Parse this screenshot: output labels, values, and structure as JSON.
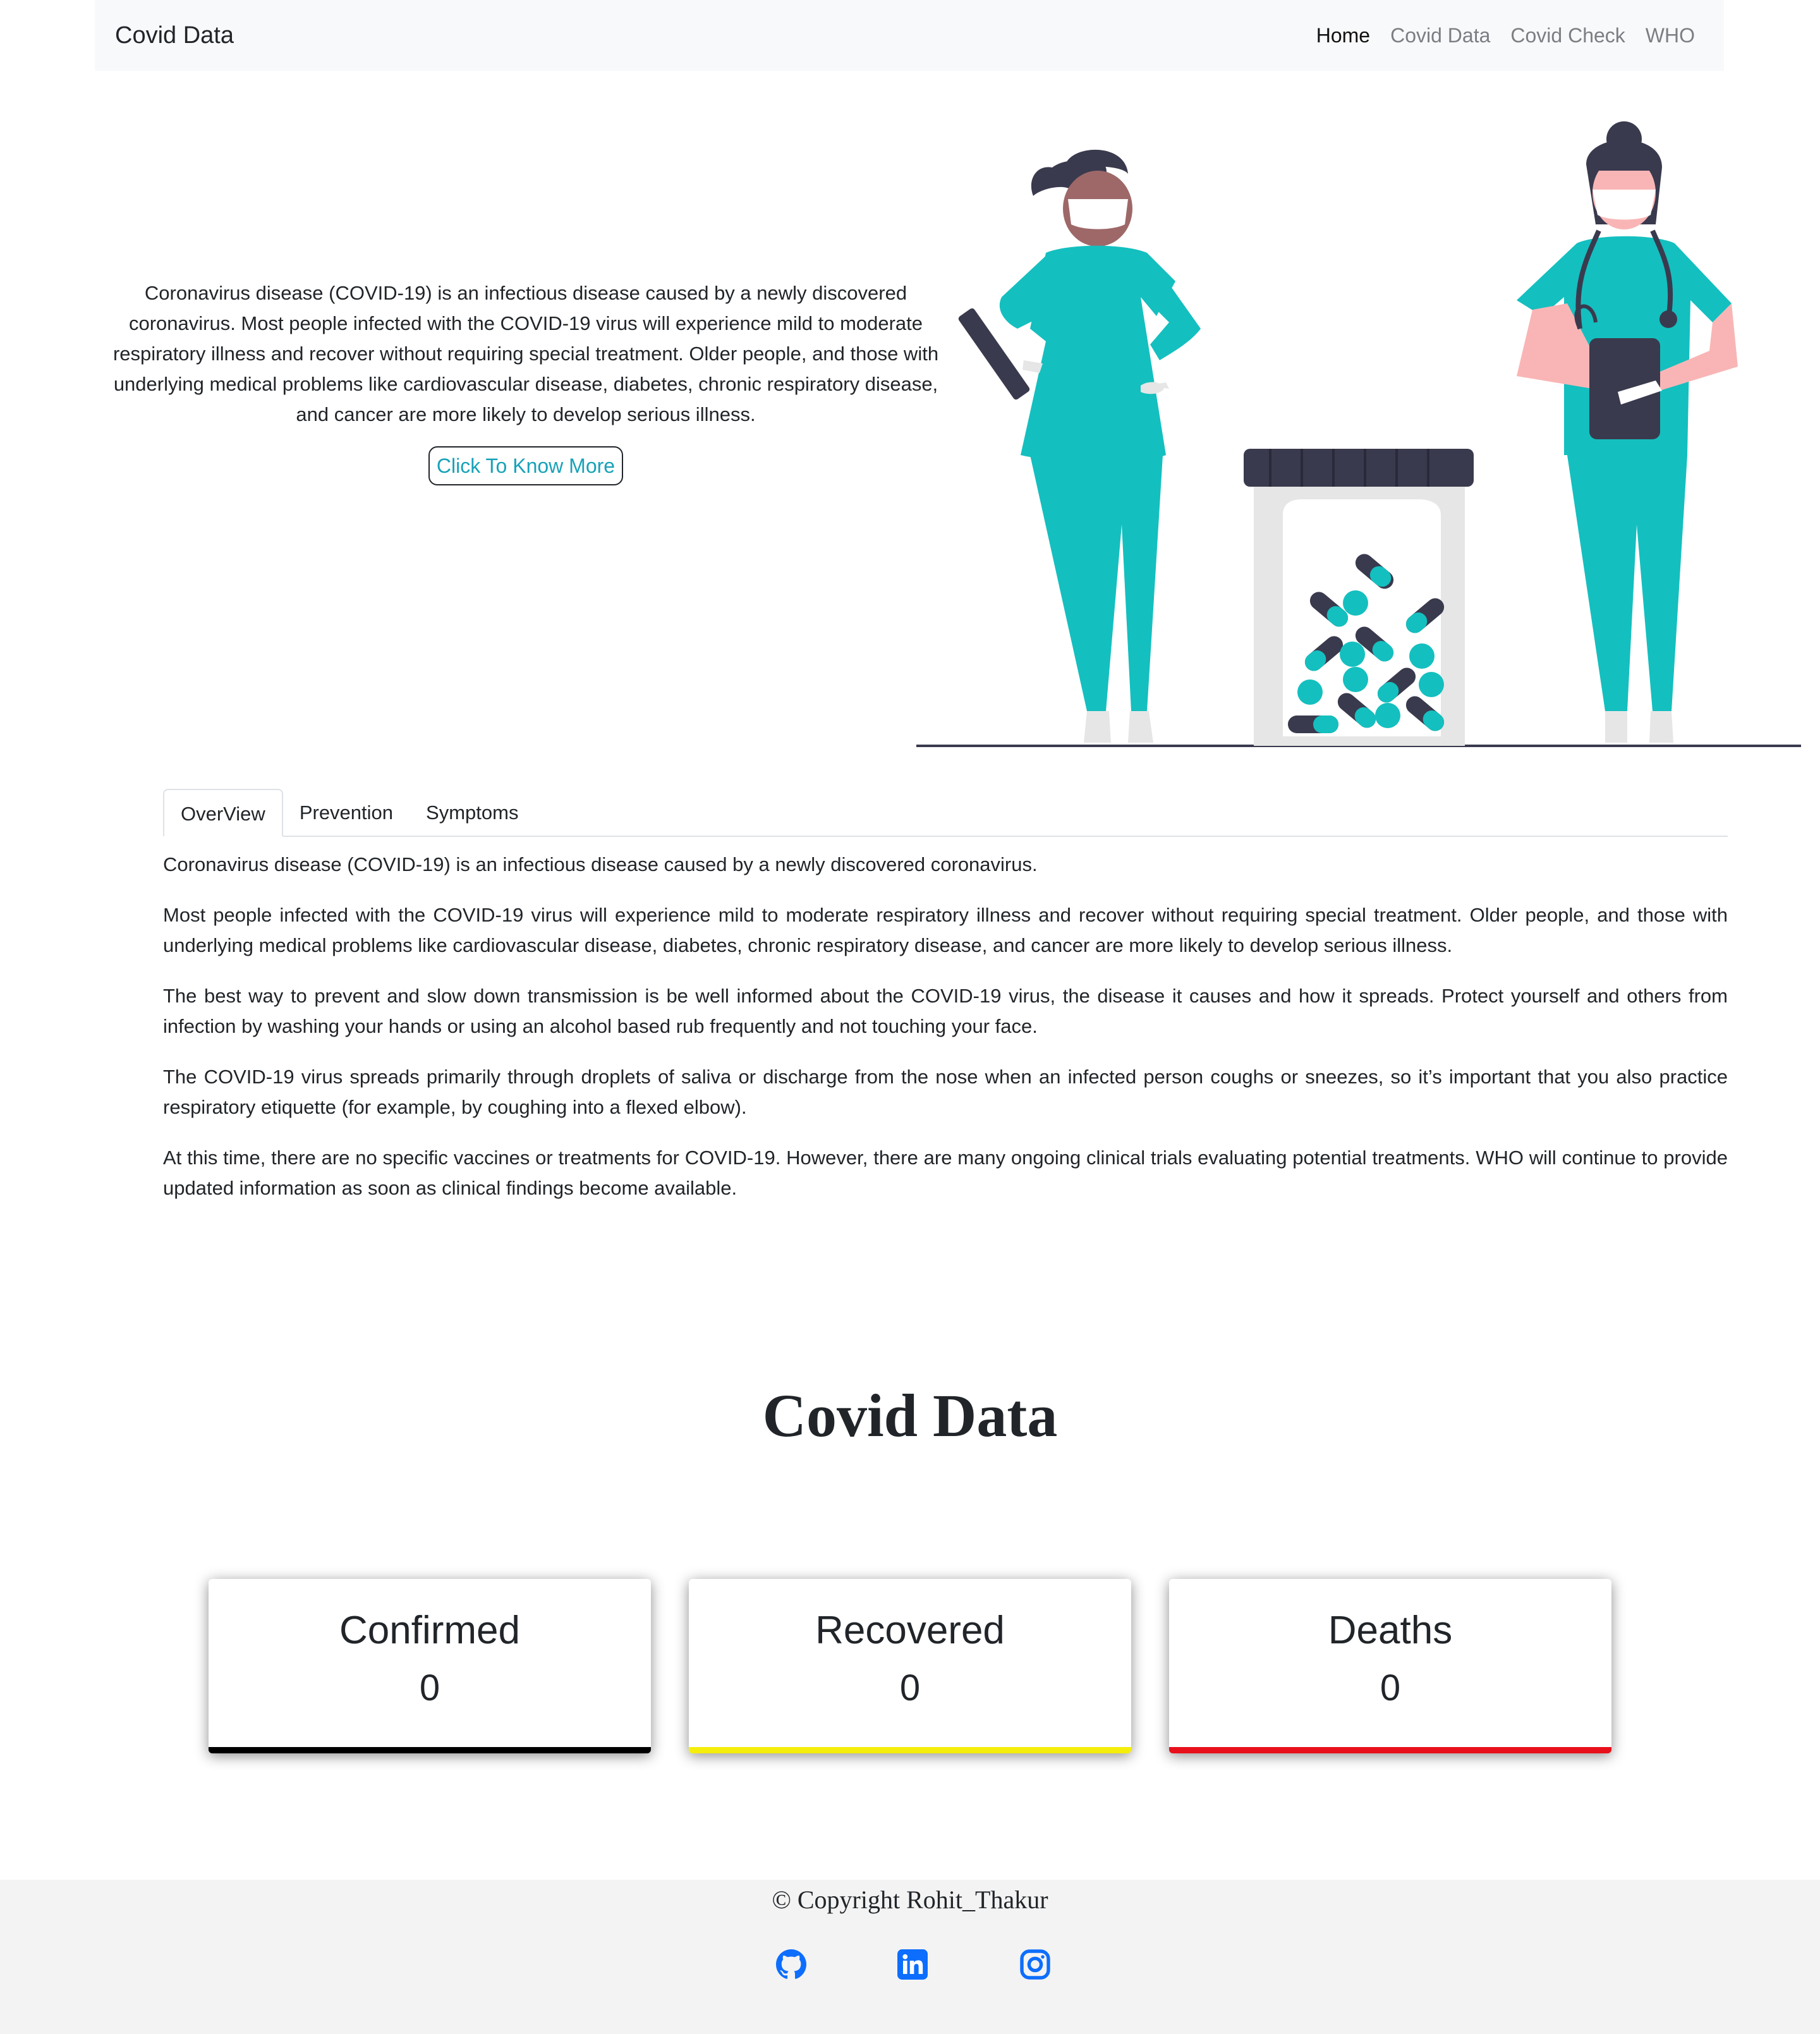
{
  "navbar": {
    "brand": "Covid Data",
    "links": [
      "Home",
      "Covid Data",
      "Covid Check",
      "WHO"
    ]
  },
  "hero": {
    "text": "Coronavirus disease (COVID-19) is an infectious disease caused by a newly discovered coronavirus. Most people infected with the COVID-19 virus will experience mild to moderate respiratory illness and recover without requiring special treatment. Older people, and those with underlying medical problems like cardiovascular disease, diabetes, chronic respiratory disease, and cancer are more likely to develop serious illness.",
    "button": "Click To Know More"
  },
  "tabs": [
    "OverView",
    "Prevention",
    "Symptoms"
  ],
  "overview": [
    "Coronavirus disease (COVID-19) is an infectious disease caused by a newly discovered coronavirus.",
    "Most people infected with the COVID-19 virus will experience mild to moderate respiratory illness and recover without requiring special treatment. Older people, and those with underlying medical problems like cardiovascular disease, diabetes, chronic respiratory disease, and cancer are more likely to develop serious illness.",
    "The best way to prevent and slow down transmission is be well informed about the COVID-19 virus, the disease it causes and how it spreads. Protect yourself and others from infection by washing your hands or using an alcohol based rub frequently and not touching your face.",
    "The COVID-19 virus spreads primarily through droplets of saliva or discharge from the nose when an infected person coughs or sneezes, so it’s important that you also practice respiratory etiquette (for example, by coughing into a flexed elbow).",
    "At this time, there are no specific vaccines or treatments for COVID-19. However, there are many ongoing clinical trials evaluating potential treatments. WHO will continue to provide updated information as soon as clinical findings become available."
  ],
  "covid_data": {
    "title": "Covid Data",
    "cards": [
      {
        "label": "Confirmed",
        "value": "0",
        "color": "#000000"
      },
      {
        "label": "Recovered",
        "value": "0",
        "color": "#f5ee0b"
      },
      {
        "label": "Deaths",
        "value": "0",
        "color": "#e8101b"
      }
    ]
  },
  "footer": {
    "copyright": "© Copyright Rohit_Thakur",
    "icons": [
      "github-icon",
      "linkedin-icon",
      "instagram-icon"
    ],
    "icon_color": "#0d6efd"
  },
  "colors": {
    "teal": "#14bfbf",
    "navy": "#3a3a4e",
    "link": "#17a2b8"
  }
}
